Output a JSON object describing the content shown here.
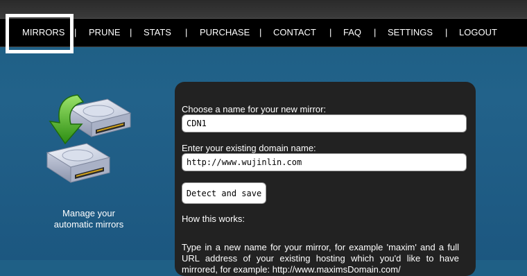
{
  "nav": {
    "items": [
      "MIRRORS",
      "PRUNE",
      "STATS",
      "PURCHASE",
      "CONTACT",
      "FAQ",
      "SETTINGS",
      "LOGOUT"
    ],
    "separator": "|",
    "active": "MIRRORS"
  },
  "sidebar": {
    "icon": "hard-drives-with-green-arrow-icon",
    "caption_line1": "Manage your",
    "caption_line2": "automatic mirrors"
  },
  "form": {
    "mirror_name_label": "Choose a name for your new mirror:",
    "mirror_name_value": "CDN1",
    "domain_label": "Enter your existing domain name:",
    "domain_value": "http://www.wujinlin.com",
    "submit_label": "Detect and save",
    "how_title": "How this works:",
    "how_text": "Type in a new name for your mirror, for example 'maxim' and a full URL address of your existing hosting which you'd like to have mirrored, for example: http://www.maximsDomain.com/"
  },
  "colors": {
    "background": "#1f6086",
    "navbar": "#000000",
    "panel": "#222222",
    "arrow": "#3aa31a"
  }
}
